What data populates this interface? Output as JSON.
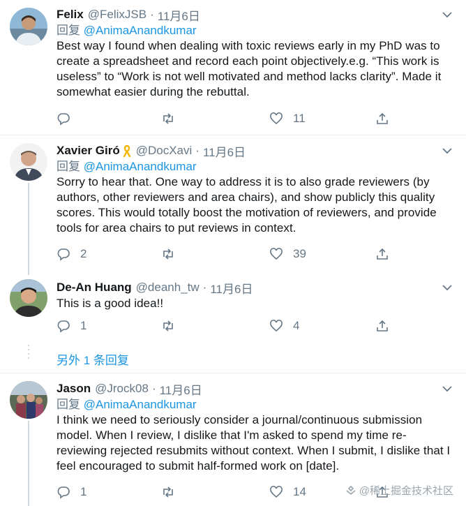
{
  "tweets": [
    {
      "name": "Felix",
      "handle": "@FelixJSB",
      "date": "11月6日",
      "reply_prefix": "回复",
      "reply_to": "@AnimaAnandkumar",
      "text": "Best way I found when dealing with toxic reviews early in my PhD was to create a spreadsheet and record each point objectively.e.g. “This work is useless” to “Work is not well motivated and method lacks clarity”. Made it somewhat easier during the rebuttal.",
      "replies": "",
      "retweets": "",
      "likes": "11"
    },
    {
      "name": "Xavier Giró",
      "handle": "@DocXavi",
      "date": "11月6日",
      "reply_prefix": "回复",
      "reply_to": "@AnimaAnandkumar",
      "text": "Sorry to hear that. One way to address it is to also grade reviewers (by authors, other reviewers and area chairs), and show publicly this quality scores. This would totally boost the motivation of reviewers, and provide tools for area chairs to put reviews in context.",
      "replies": "2",
      "retweets": "",
      "likes": "39"
    },
    {
      "name": "De-An Huang",
      "handle": "@deanh_tw",
      "date": "11月6日",
      "text": "This is a good idea!!",
      "replies": "1",
      "retweets": "",
      "likes": "4"
    },
    {
      "name": "Jason",
      "handle": "@Jrock08",
      "date": "11月6日",
      "reply_prefix": "回复",
      "reply_to": "@AnimaAnandkumar",
      "text": "I think we need to seriously consider a journal/continuous submission model. When I review, I dislike that I'm asked to spend my time re-reviewing rejected resubmits without context.  When I submit, I dislike that I feel encouraged to submit half-formed work on [date].",
      "replies": "1",
      "retweets": "",
      "likes": "14"
    }
  ],
  "more_replies": "另外 1 条回复",
  "separator": "·",
  "watermark": "@稀土掘金技术社区",
  "colors": {
    "link": "#1b95e0",
    "muted": "#657786",
    "line": "#cfd9de"
  }
}
